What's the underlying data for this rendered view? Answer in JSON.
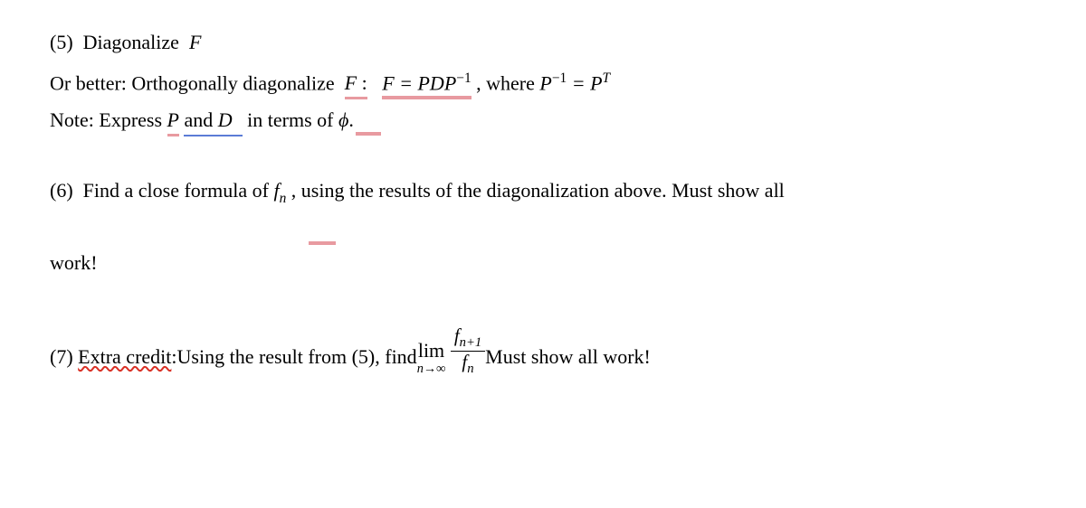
{
  "p5": {
    "num": "(5)",
    "title": "Diagonalize",
    "F": "F",
    "or_better": "Or better:  Orthogonally diagonalize",
    "F2": "F",
    "colon": ":",
    "eq": "F = PDP",
    "sup1": "−1",
    "where": ", where ",
    "P": "P",
    "supn1": "−1",
    "eq2": " = P",
    "supT": "T",
    "note": "Note: Express ",
    "Pvar": "P",
    "and": " and ",
    "Dvar": "D",
    "interms": " in terms of ",
    "phi": "ϕ",
    "period": "."
  },
  "p6": {
    "num": "(6)",
    "text1": "Find a close formula of ",
    "fn": "f",
    "nsub": "n",
    "comma": ",",
    "text2": " using the results of the diagonalization above.  Must show all",
    "work": "work!"
  },
  "p7": {
    "num": "(7)",
    "extra": "Extra credit",
    "colon": ":",
    "text1": "  Using the result from (5), find ",
    "lim": "lim",
    "cond": "n→∞",
    "f": "f",
    "np1": "n+1",
    "fn": "f",
    "nn": "n",
    "text2": "  Must show all work!"
  }
}
